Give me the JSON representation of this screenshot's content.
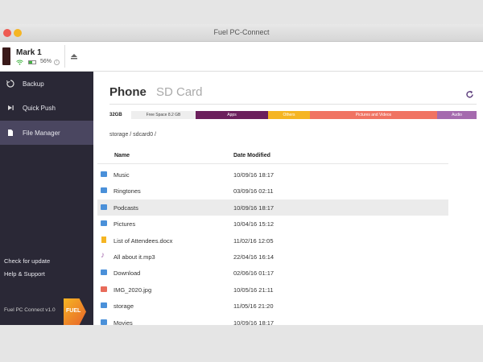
{
  "window": {
    "title": "Fuel PC-Connect"
  },
  "device": {
    "name": "Mark 1",
    "battery": "56%"
  },
  "sidebar": {
    "items": [
      {
        "label": "Backup",
        "icon": "backup-icon"
      },
      {
        "label": "Quick Push",
        "icon": "push-icon"
      },
      {
        "label": "File Manager",
        "icon": "file-manager-icon"
      }
    ],
    "links": {
      "update": "Check for update",
      "help": "Help & Support"
    },
    "version": "Fuel PC Connect v1.0"
  },
  "tabs": {
    "phone": "Phone",
    "sdcard": "SD Card"
  },
  "storage": {
    "total": "32GB",
    "segments": [
      {
        "label": "Free Space 8.2 GB",
        "color": "#eeeeee"
      },
      {
        "label": "Apps",
        "color": "#6b1f5c"
      },
      {
        "label": "Others",
        "color": "#f5b523"
      },
      {
        "label": "Pictures and Videos",
        "color": "#f07362"
      },
      {
        "label": "Audio",
        "color": "#a56aae"
      }
    ]
  },
  "path": "storage / sdcard0 /",
  "columns": {
    "name": "Name",
    "date": "Date Modified"
  },
  "files": [
    {
      "type": "folder",
      "name": "Music",
      "date": "10/09/16 18:17"
    },
    {
      "type": "folder",
      "name": "Ringtones",
      "date": "03/09/16 02:11"
    },
    {
      "type": "folder",
      "name": "Podcasts",
      "date": "10/09/16 18:17"
    },
    {
      "type": "folder",
      "name": "Pictures",
      "date": "10/04/16 15:12"
    },
    {
      "type": "doc",
      "name": "List of Attendees.docx",
      "date": "11/02/16 12:05"
    },
    {
      "type": "audio",
      "name": "All about it.mp3",
      "date": "22/04/16 16:14"
    },
    {
      "type": "folder",
      "name": "Download",
      "date": "02/06/16 01:17"
    },
    {
      "type": "image",
      "name": "IMG_2020.jpg",
      "date": "10/05/16 21:11"
    },
    {
      "type": "folder",
      "name": "storage",
      "date": "11/05/16 21:20"
    },
    {
      "type": "folder",
      "name": "Movies",
      "date": "10/09/16 18:17"
    }
  ],
  "selected_row": 2,
  "brand": {
    "logo_text": "FUEL"
  }
}
